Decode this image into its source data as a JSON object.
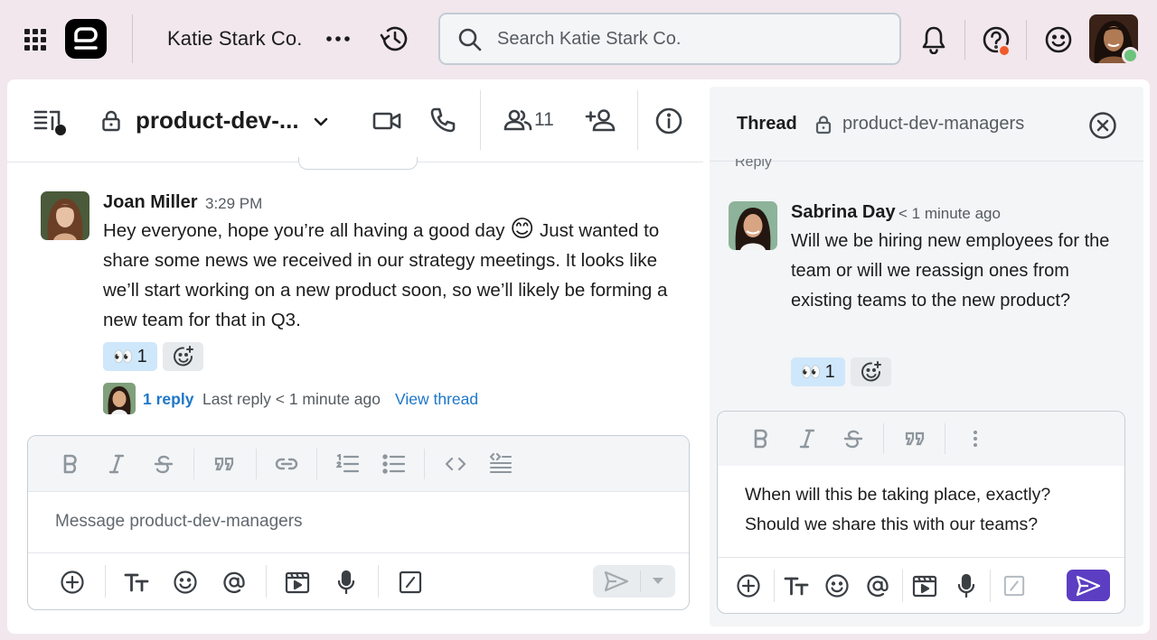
{
  "topbar": {
    "workspace_name": "Katie Stark Co.",
    "search_placeholder": "Search Katie Stark Co.",
    "icons": [
      "apps-grid-icon",
      "app-logo",
      "more-icon",
      "history-icon",
      "search-icon",
      "bell-icon",
      "help-icon",
      "emoji-status-icon"
    ]
  },
  "channel": {
    "name": "product-dev-...",
    "member_count": "11",
    "icons": [
      "channels-list-icon",
      "lock-icon",
      "chevron-down-icon",
      "video-icon",
      "phone-icon",
      "members-icon",
      "add-member-icon",
      "info-icon"
    ]
  },
  "message": {
    "sender": "Joan Miller",
    "time": "3:29 PM",
    "text_before_emoji": "Hey everyone, hope you’re all having a good day",
    "emoji": "😊",
    "text_after_emoji": "Just wanted to share some news we received in our strategy meetings. It looks like we’ll start working on a new product soon, so we’ll likely be forming a new team for that in Q3.",
    "reaction_emoji": "👀",
    "reaction_count": "1",
    "reply_count_label": "1 reply",
    "last_reply_label": "Last reply < 1 minute ago",
    "view_thread_label": "View thread"
  },
  "main_composer": {
    "placeholder": "Message product-dev-managers",
    "format_tools": [
      "bold",
      "italic",
      "strikethrough",
      "quote",
      "link",
      "ordered-list",
      "bulleted-list",
      "code",
      "code-block"
    ],
    "actions": [
      "add",
      "text-format",
      "emoji",
      "mention",
      "video-message",
      "voice-message",
      "slash-command",
      "send",
      "send-options"
    ]
  },
  "thread": {
    "title": "Thread",
    "channel": "product-dev-managers",
    "cut_off_text": "Reply",
    "reply": {
      "sender": "Sabrina Day",
      "time": "< 1 minute ago",
      "text": "Will we be hiring new employees for the team or will we reassign ones from existing teams to the new product?",
      "reaction_emoji": "👀",
      "reaction_count": "1"
    },
    "composer_text_line1": "When will this be taking place, exactly?",
    "composer_text_line2": "Should we share this with our teams?"
  },
  "colors": {
    "background": "#f1e7ec",
    "link": "#1e77c9",
    "send_active": "#5c3ec2",
    "reaction_active": "#cfe7fb",
    "notification": "#ef5a2a",
    "presence": "#6cc37c"
  }
}
